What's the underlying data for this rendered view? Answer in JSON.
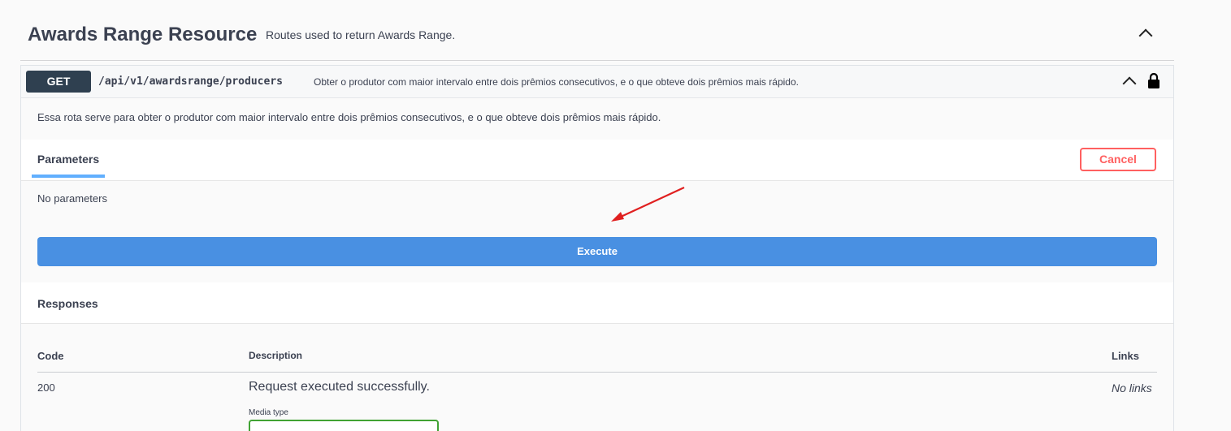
{
  "tag": {
    "title": "Awards Range Resource",
    "description": "Routes used to return Awards Range."
  },
  "operation": {
    "method": "GET",
    "path": "/api/v1/awardsrange/producers",
    "summary": "Obter o produtor com maior intervalo entre dois prêmios consecutivos, e o que obteve dois prêmios mais rápido.",
    "description": "Essa rota serve para obter o produtor com maior intervalo entre dois prêmios consecutivos, e o que obteve dois prêmios mais rápido."
  },
  "parameters": {
    "tab_label": "Parameters",
    "cancel_label": "Cancel",
    "empty_text": "No parameters",
    "execute_label": "Execute"
  },
  "responses": {
    "title": "Responses",
    "headers": {
      "code": "Code",
      "description": "Description",
      "links": "Links"
    },
    "rows": [
      {
        "code": "200",
        "description": "Request executed successfully.",
        "links": "No links",
        "media_type_label": "Media type"
      }
    ]
  },
  "colors": {
    "method_badge": "#2f4050",
    "execute_button": "#4990e2",
    "cancel_button": "#ff6060",
    "active_tab_underline": "#61affe",
    "annotation_arrow": "#e02020"
  }
}
